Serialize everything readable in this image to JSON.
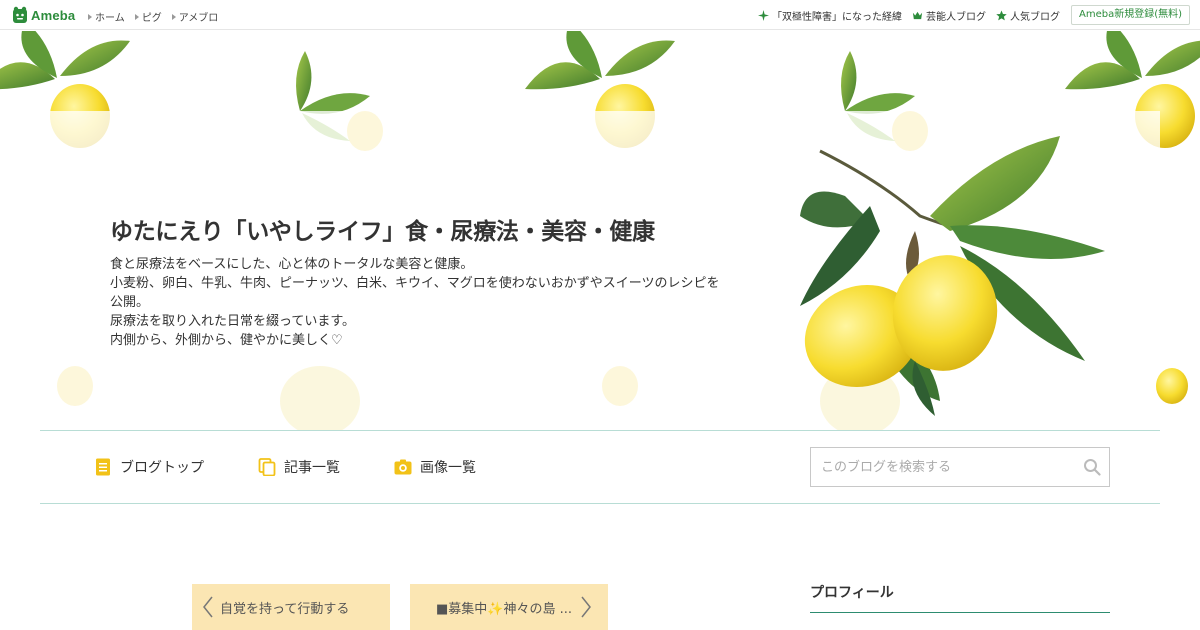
{
  "topbar": {
    "logo_text": "Ameba",
    "nav": [
      {
        "label": "ホーム"
      },
      {
        "label": "ピグ"
      },
      {
        "label": "アメブロ"
      }
    ],
    "right_links": [
      {
        "label": "「双極性障害」になった経緯",
        "icon": "sparkle-icon"
      },
      {
        "label": "芸能人ブログ",
        "icon": "crown-icon"
      },
      {
        "label": "人気ブログ",
        "icon": "star-icon"
      }
    ],
    "register_label": "Ameba新規登録(無料)"
  },
  "header": {
    "title": "ゆたにえり「いやしライフ」食・尿療法・美容・健康",
    "description": [
      "食と尿療法をベースにした、心と体のトータルな美容と健康。",
      "小麦粉、卵白、牛乳、牛肉、ピーナッツ、白米、キウイ、マグロを使わないおかずやスイーツのレシピを公開。",
      "尿療法を取り入れた日常を綴っています。",
      "内側から、外側から、健やかに美しく♡"
    ]
  },
  "blognav": {
    "items": [
      {
        "label": "ブログトップ",
        "icon": "document-icon"
      },
      {
        "label": "記事一覧",
        "icon": "copy-icon"
      },
      {
        "label": "画像一覧",
        "icon": "camera-icon"
      }
    ],
    "search_placeholder": "このブログを検索する"
  },
  "pager": {
    "prev_label": "自覚を持って行動する",
    "next_label": "■募集中✨神々の島 ..."
  },
  "sidebar": {
    "profile_heading": "プロフィール"
  },
  "colors": {
    "brand_green": "#2d8c3c",
    "pager_bg": "#fbe6b3",
    "nav_icon": "#f2c218",
    "divider": "#b8ddd5"
  }
}
